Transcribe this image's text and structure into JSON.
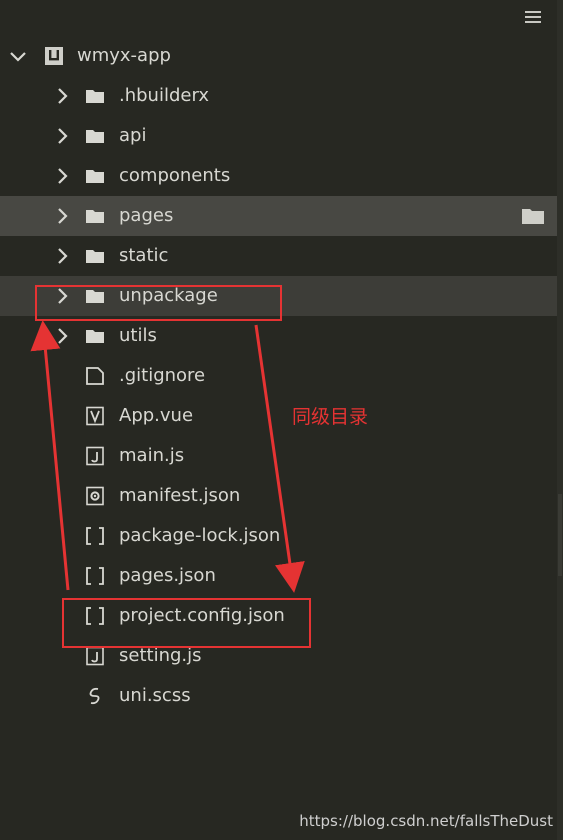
{
  "project": {
    "name": "wmyx-app"
  },
  "tree": {
    "folders": [
      {
        "label": ".hbuilderx"
      },
      {
        "label": "api"
      },
      {
        "label": "components"
      },
      {
        "label": "pages"
      },
      {
        "label": "static"
      },
      {
        "label": "unpackage"
      },
      {
        "label": "utils"
      }
    ],
    "files": [
      {
        "label": ".gitignore",
        "icon": "file-icon"
      },
      {
        "label": "App.vue",
        "icon": "vue-file-icon"
      },
      {
        "label": "main.js",
        "icon": "js-file-icon"
      },
      {
        "label": "manifest.json",
        "icon": "gear-file-icon"
      },
      {
        "label": "package-lock.json",
        "icon": "json-bracket-icon"
      },
      {
        "label": "pages.json",
        "icon": "json-bracket-icon"
      },
      {
        "label": "project.config.json",
        "icon": "json-bracket-icon"
      },
      {
        "label": "setting.js",
        "icon": "js-file-icon"
      },
      {
        "label": "uni.scss",
        "icon": "sass-icon"
      }
    ]
  },
  "annotation": {
    "text": "同级目录",
    "color": "#e53333"
  },
  "watermark": {
    "text": "https://blog.csdn.net/fallsTheDust"
  },
  "colors": {
    "background": "#272822",
    "text": "#d8d8d2",
    "icon": "#d8d8d2",
    "hover_row": "#3d3d38",
    "selected_row": "#484843"
  }
}
